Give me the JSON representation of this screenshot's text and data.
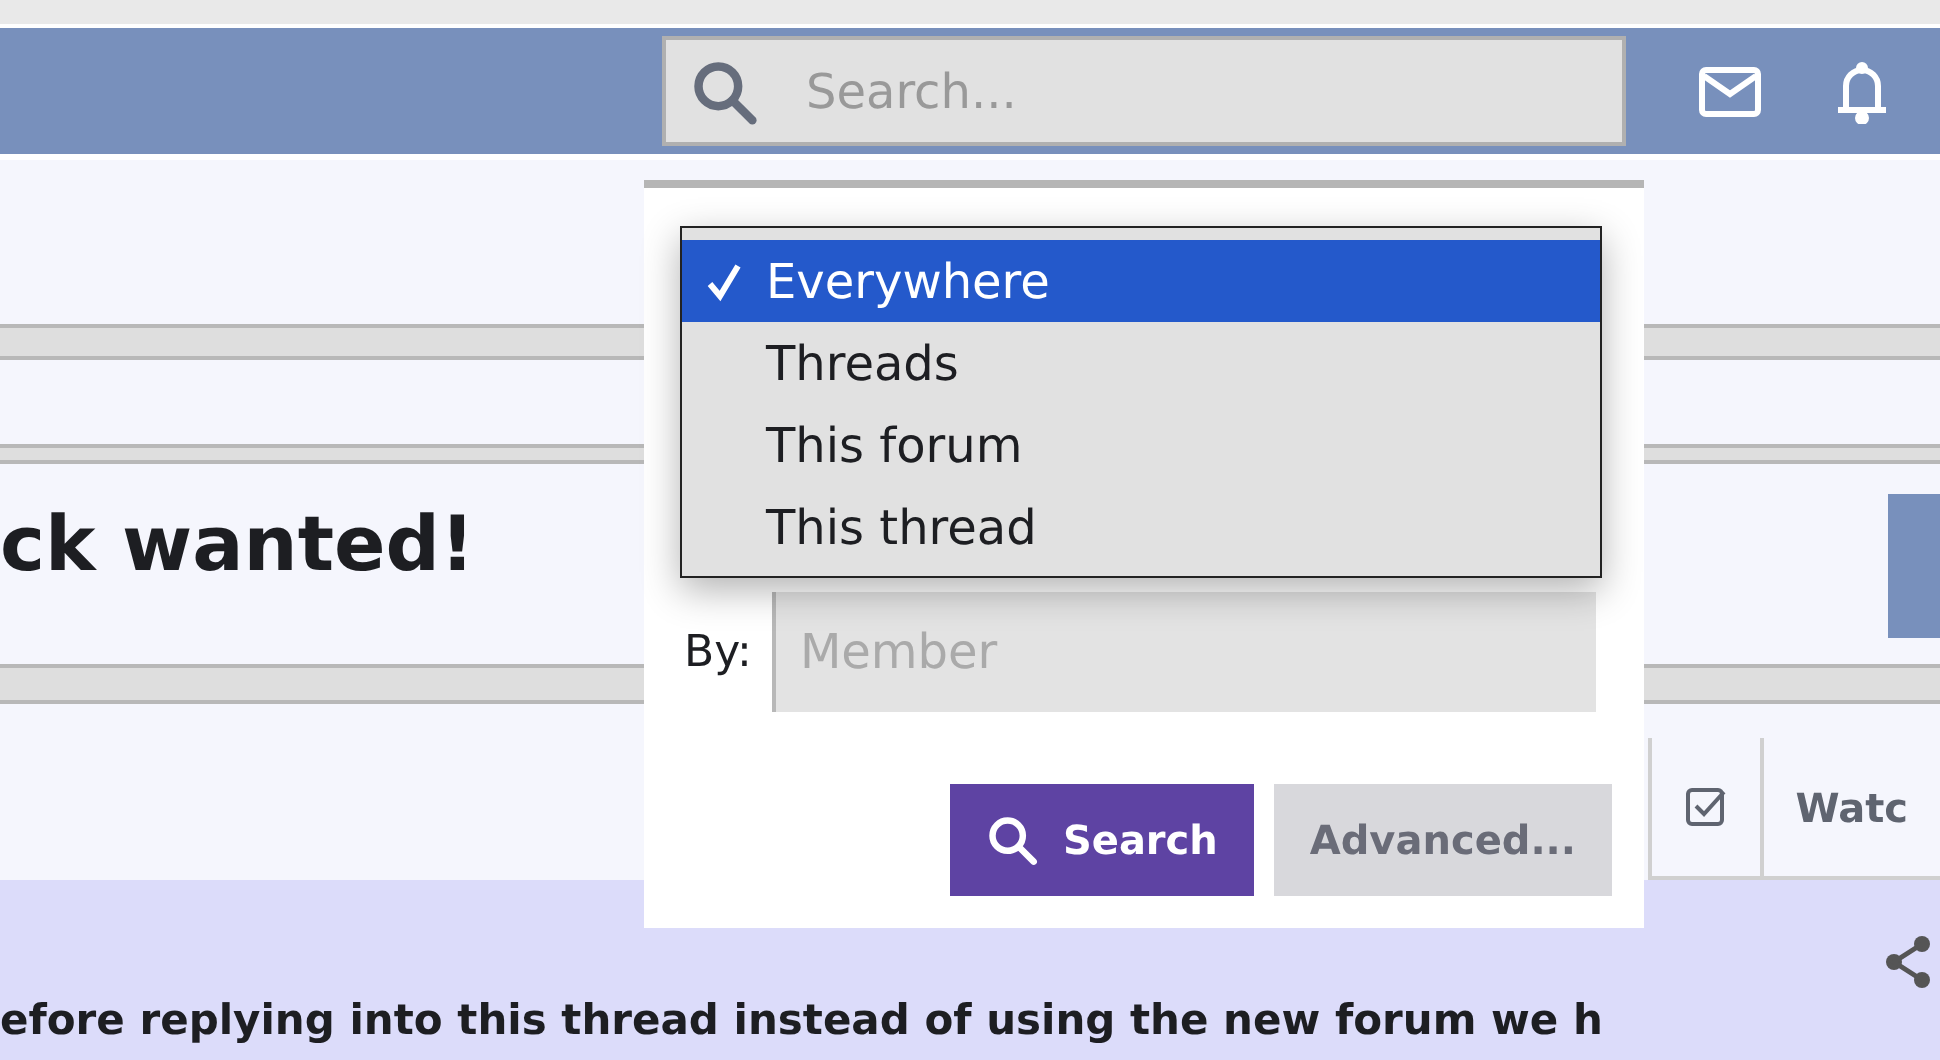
{
  "header": {
    "search": {
      "placeholder": "Search..."
    }
  },
  "thread": {
    "title": "ck wanted!"
  },
  "toolbar": {
    "watch_label": "Watc"
  },
  "notice": {
    "text": "efore replying into this thread instead of using the new forum we h"
  },
  "search_popup": {
    "scope_options": [
      {
        "label": "Everywhere",
        "selected": true
      },
      {
        "label": "Threads",
        "selected": false
      },
      {
        "label": "This forum",
        "selected": false
      },
      {
        "label": "This thread",
        "selected": false
      }
    ],
    "by_label": "By:",
    "member": {
      "placeholder": "Member"
    },
    "buttons": [
      {
        "label": "Search",
        "kind": "primary"
      },
      {
        "label": "Advanced...",
        "kind": "secondary"
      }
    ]
  }
}
